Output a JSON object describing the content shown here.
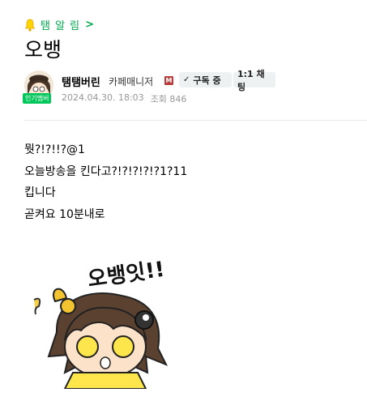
{
  "topic": {
    "label": "탬 알 림",
    "chevron": ">"
  },
  "post": {
    "title": "오뱅"
  },
  "author": {
    "nickname": "탬탬버린",
    "role": "카페매니저",
    "manager_icon": "M",
    "popular_badge": "인기멤버",
    "date": "2024.04.30. 18:03",
    "views_label": "조회 846"
  },
  "actions": {
    "subscribe_label": "구독 중",
    "chat_label": "1:1 채팅"
  },
  "content": {
    "lines": [
      "뭣?!?!!?@1",
      "오늘방송을 킨다고?!?!?!?!?1?11",
      "킵니다",
      "곧켜요 10분내로"
    ]
  },
  "sticker": {
    "text": "오뱅잇!!"
  },
  "colors": {
    "accent": "#03a94f",
    "badge": "#03c75a",
    "meta": "#979797"
  }
}
